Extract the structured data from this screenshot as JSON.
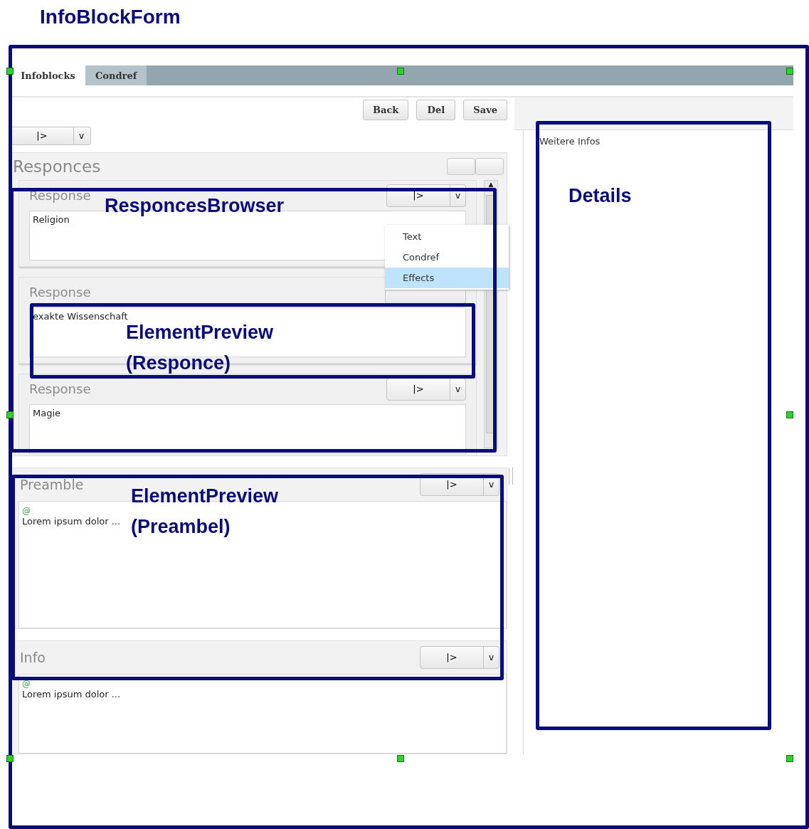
{
  "title": "InfoBlockForm",
  "tabs": [
    {
      "label": "Infoblocks",
      "selected": true
    },
    {
      "label": "Condref",
      "selected": false
    }
  ],
  "toolbar": {
    "buttons": [
      "Back",
      "Del",
      "Save"
    ]
  },
  "top_split_button": {
    "label": "|>",
    "caret": "v"
  },
  "responses_browser": {
    "title": "Responces",
    "scroll_up": "▲",
    "items": [
      {
        "title": "Response",
        "text": "Religion",
        "button": "|>",
        "caret": "v"
      },
      {
        "title": "Response",
        "text": "exakte Wissenschaft"
      },
      {
        "title": "Response",
        "text": "Magie",
        "button": "|>",
        "caret": "v"
      }
    ]
  },
  "dropdown_menu": {
    "items": [
      {
        "label": "Text",
        "selected": false
      },
      {
        "label": "Condref",
        "selected": false
      },
      {
        "label": "Effects",
        "selected": true
      }
    ]
  },
  "preamble": {
    "title": "Preamble",
    "marker": "@",
    "text": "Lorem ipsum dolor ...",
    "button": "|>",
    "caret": "v"
  },
  "info": {
    "title": "Info",
    "marker": "@",
    "text": "Lorem ipsum dolor ...",
    "button": "|>",
    "caret": "v"
  },
  "details": {
    "text": "Weitere Infos"
  },
  "annotations": [
    {
      "lines": [
        "ResponcesBrowser"
      ]
    },
    {
      "lines": [
        "ElementPreview",
        "(Responce)"
      ]
    },
    {
      "lines": [
        "ElementPreview",
        "(Preambel)"
      ]
    },
    {
      "lines": [
        "Details"
      ]
    }
  ]
}
